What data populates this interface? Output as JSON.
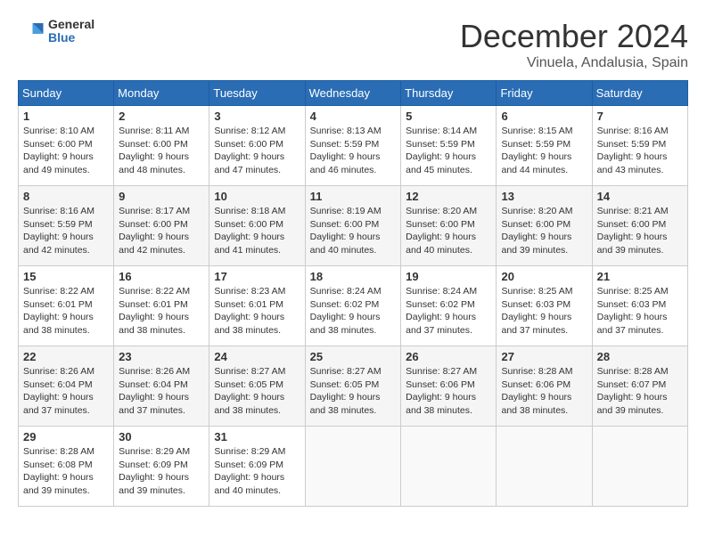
{
  "header": {
    "logo_general": "General",
    "logo_blue": "Blue",
    "month": "December 2024",
    "location": "Vinuela, Andalusia, Spain"
  },
  "weekdays": [
    "Sunday",
    "Monday",
    "Tuesday",
    "Wednesday",
    "Thursday",
    "Friday",
    "Saturday"
  ],
  "weeks": [
    [
      {
        "day": 1,
        "sunrise": "Sunrise: 8:10 AM",
        "sunset": "Sunset: 6:00 PM",
        "daylight": "Daylight: 9 hours and 49 minutes."
      },
      {
        "day": 2,
        "sunrise": "Sunrise: 8:11 AM",
        "sunset": "Sunset: 6:00 PM",
        "daylight": "Daylight: 9 hours and 48 minutes."
      },
      {
        "day": 3,
        "sunrise": "Sunrise: 8:12 AM",
        "sunset": "Sunset: 6:00 PM",
        "daylight": "Daylight: 9 hours and 47 minutes."
      },
      {
        "day": 4,
        "sunrise": "Sunrise: 8:13 AM",
        "sunset": "Sunset: 5:59 PM",
        "daylight": "Daylight: 9 hours and 46 minutes."
      },
      {
        "day": 5,
        "sunrise": "Sunrise: 8:14 AM",
        "sunset": "Sunset: 5:59 PM",
        "daylight": "Daylight: 9 hours and 45 minutes."
      },
      {
        "day": 6,
        "sunrise": "Sunrise: 8:15 AM",
        "sunset": "Sunset: 5:59 PM",
        "daylight": "Daylight: 9 hours and 44 minutes."
      },
      {
        "day": 7,
        "sunrise": "Sunrise: 8:16 AM",
        "sunset": "Sunset: 5:59 PM",
        "daylight": "Daylight: 9 hours and 43 minutes."
      }
    ],
    [
      {
        "day": 8,
        "sunrise": "Sunrise: 8:16 AM",
        "sunset": "Sunset: 5:59 PM",
        "daylight": "Daylight: 9 hours and 42 minutes."
      },
      {
        "day": 9,
        "sunrise": "Sunrise: 8:17 AM",
        "sunset": "Sunset: 6:00 PM",
        "daylight": "Daylight: 9 hours and 42 minutes."
      },
      {
        "day": 10,
        "sunrise": "Sunrise: 8:18 AM",
        "sunset": "Sunset: 6:00 PM",
        "daylight": "Daylight: 9 hours and 41 minutes."
      },
      {
        "day": 11,
        "sunrise": "Sunrise: 8:19 AM",
        "sunset": "Sunset: 6:00 PM",
        "daylight": "Daylight: 9 hours and 40 minutes."
      },
      {
        "day": 12,
        "sunrise": "Sunrise: 8:20 AM",
        "sunset": "Sunset: 6:00 PM",
        "daylight": "Daylight: 9 hours and 40 minutes."
      },
      {
        "day": 13,
        "sunrise": "Sunrise: 8:20 AM",
        "sunset": "Sunset: 6:00 PM",
        "daylight": "Daylight: 9 hours and 39 minutes."
      },
      {
        "day": 14,
        "sunrise": "Sunrise: 8:21 AM",
        "sunset": "Sunset: 6:00 PM",
        "daylight": "Daylight: 9 hours and 39 minutes."
      }
    ],
    [
      {
        "day": 15,
        "sunrise": "Sunrise: 8:22 AM",
        "sunset": "Sunset: 6:01 PM",
        "daylight": "Daylight: 9 hours and 38 minutes."
      },
      {
        "day": 16,
        "sunrise": "Sunrise: 8:22 AM",
        "sunset": "Sunset: 6:01 PM",
        "daylight": "Daylight: 9 hours and 38 minutes."
      },
      {
        "day": 17,
        "sunrise": "Sunrise: 8:23 AM",
        "sunset": "Sunset: 6:01 PM",
        "daylight": "Daylight: 9 hours and 38 minutes."
      },
      {
        "day": 18,
        "sunrise": "Sunrise: 8:24 AM",
        "sunset": "Sunset: 6:02 PM",
        "daylight": "Daylight: 9 hours and 38 minutes."
      },
      {
        "day": 19,
        "sunrise": "Sunrise: 8:24 AM",
        "sunset": "Sunset: 6:02 PM",
        "daylight": "Daylight: 9 hours and 37 minutes."
      },
      {
        "day": 20,
        "sunrise": "Sunrise: 8:25 AM",
        "sunset": "Sunset: 6:03 PM",
        "daylight": "Daylight: 9 hours and 37 minutes."
      },
      {
        "day": 21,
        "sunrise": "Sunrise: 8:25 AM",
        "sunset": "Sunset: 6:03 PM",
        "daylight": "Daylight: 9 hours and 37 minutes."
      }
    ],
    [
      {
        "day": 22,
        "sunrise": "Sunrise: 8:26 AM",
        "sunset": "Sunset: 6:04 PM",
        "daylight": "Daylight: 9 hours and 37 minutes."
      },
      {
        "day": 23,
        "sunrise": "Sunrise: 8:26 AM",
        "sunset": "Sunset: 6:04 PM",
        "daylight": "Daylight: 9 hours and 37 minutes."
      },
      {
        "day": 24,
        "sunrise": "Sunrise: 8:27 AM",
        "sunset": "Sunset: 6:05 PM",
        "daylight": "Daylight: 9 hours and 38 minutes."
      },
      {
        "day": 25,
        "sunrise": "Sunrise: 8:27 AM",
        "sunset": "Sunset: 6:05 PM",
        "daylight": "Daylight: 9 hours and 38 minutes."
      },
      {
        "day": 26,
        "sunrise": "Sunrise: 8:27 AM",
        "sunset": "Sunset: 6:06 PM",
        "daylight": "Daylight: 9 hours and 38 minutes."
      },
      {
        "day": 27,
        "sunrise": "Sunrise: 8:28 AM",
        "sunset": "Sunset: 6:06 PM",
        "daylight": "Daylight: 9 hours and 38 minutes."
      },
      {
        "day": 28,
        "sunrise": "Sunrise: 8:28 AM",
        "sunset": "Sunset: 6:07 PM",
        "daylight": "Daylight: 9 hours and 39 minutes."
      }
    ],
    [
      {
        "day": 29,
        "sunrise": "Sunrise: 8:28 AM",
        "sunset": "Sunset: 6:08 PM",
        "daylight": "Daylight: 9 hours and 39 minutes."
      },
      {
        "day": 30,
        "sunrise": "Sunrise: 8:29 AM",
        "sunset": "Sunset: 6:09 PM",
        "daylight": "Daylight: 9 hours and 39 minutes."
      },
      {
        "day": 31,
        "sunrise": "Sunrise: 8:29 AM",
        "sunset": "Sunset: 6:09 PM",
        "daylight": "Daylight: 9 hours and 40 minutes."
      },
      null,
      null,
      null,
      null
    ]
  ]
}
